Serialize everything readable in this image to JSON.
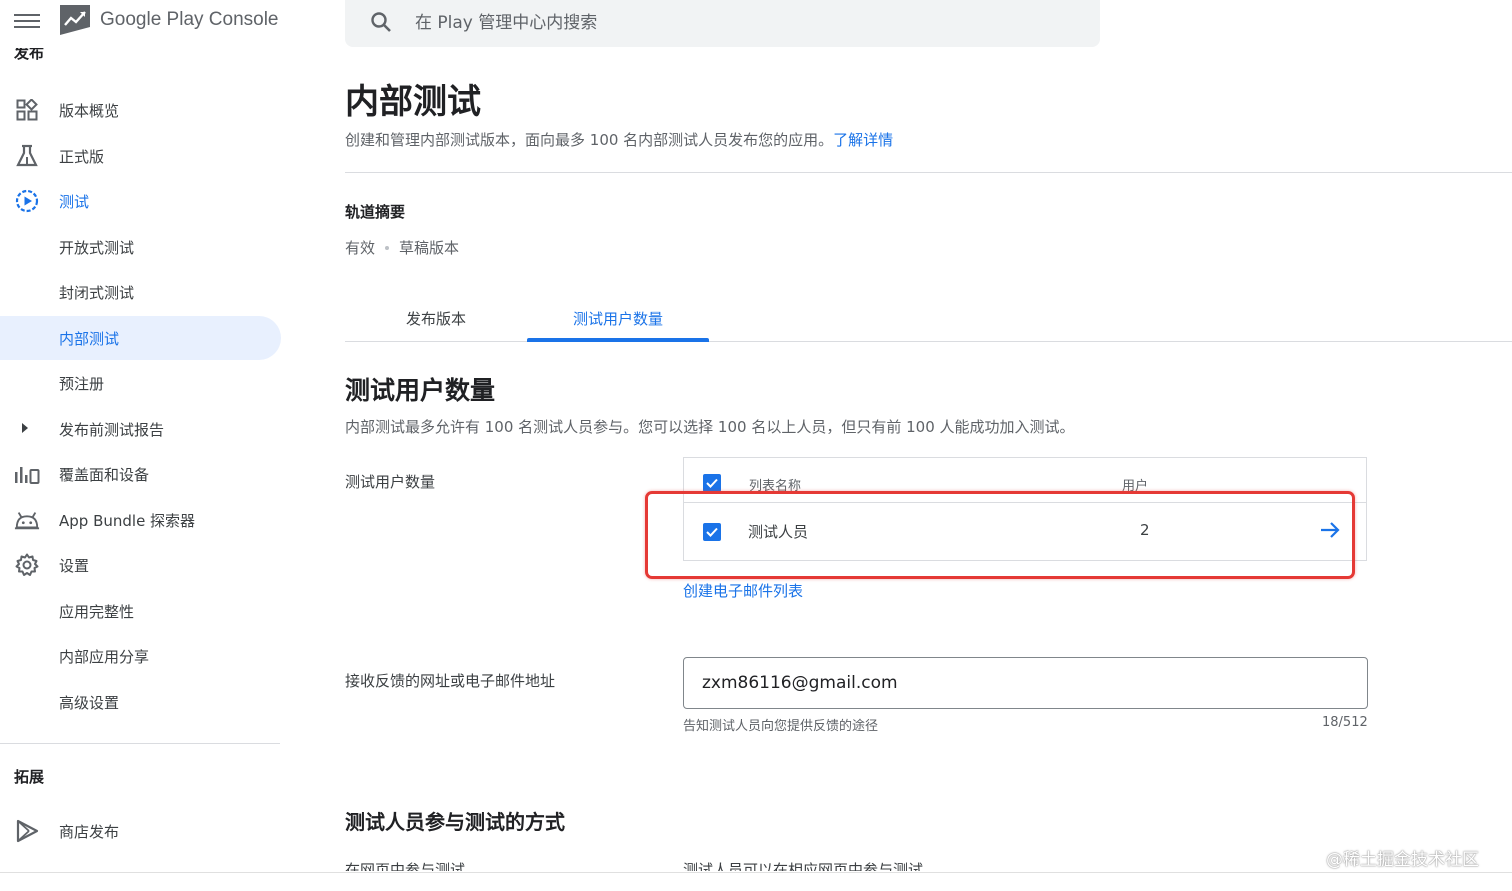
{
  "app": {
    "logo_text": "Google Play Console"
  },
  "search": {
    "placeholder": "在 Play 管理中心内搜索"
  },
  "sidebar": {
    "cut_heading": "发布",
    "items": [
      {
        "label": "版本概览",
        "icon": "dashboard-icon"
      },
      {
        "label": "正式版",
        "icon": "flask-icon"
      },
      {
        "label": "测试",
        "icon": "play-circle-icon"
      },
      {
        "label": "开放式测试"
      },
      {
        "label": "封闭式测试"
      },
      {
        "label": "内部测试"
      },
      {
        "label": "预注册"
      },
      {
        "label": "发布前测试报告",
        "icon": "caret-right-icon"
      },
      {
        "label": "覆盖面和设备",
        "icon": "bar-chart-icon"
      },
      {
        "label": "App Bundle 探索器",
        "icon": "android-icon"
      },
      {
        "label": "设置",
        "icon": "gear-icon"
      },
      {
        "label": "应用完整性"
      },
      {
        "label": "内部应用分享"
      },
      {
        "label": "高级设置"
      }
    ],
    "section_expand": "拓展",
    "store_item": {
      "label": "商店发布",
      "icon": "play-outline-icon"
    }
  },
  "main": {
    "title": "内部测试",
    "description": "创建和管理内部测试版本，面向最多 100 名内部测试人员发布您的应用。",
    "learn_more": "了解详情",
    "track_summary": {
      "heading": "轨道摘要",
      "status": "有效",
      "draft": "草稿版本"
    },
    "tabs": [
      {
        "label": "发布版本"
      },
      {
        "label": "测试用户数量"
      }
    ],
    "section_title": "测试用户数量",
    "section_desc": "内部测试最多允许有 100 名测试人员参与。您可以选择 100 名以上人员，但只有前 100 人能成功加入测试。",
    "testers_label": "测试用户数量",
    "list": {
      "col_name": "列表名称",
      "col_users": "用户",
      "rows": [
        {
          "name": "测试人员",
          "users": "2"
        }
      ]
    },
    "create_list": "创建电子邮件列表",
    "feedback_label": "接收反馈的网址或电子邮件地址",
    "feedback_value": "zxm86116@gmail.com",
    "feedback_helper": "告知测试人员向您提供反馈的途径",
    "feedback_counter": "18/512",
    "section_title2": "测试人员参与测试的方式",
    "bottom_left": "在网页中参与测试",
    "bottom_right": "测试人员可以在相应网页中参与测试"
  },
  "watermark": "@稀土掘金技术社区",
  "colors": {
    "accent": "#1a73e8",
    "highlight": "#e53935",
    "selected_bg": "#e8f0fe"
  }
}
